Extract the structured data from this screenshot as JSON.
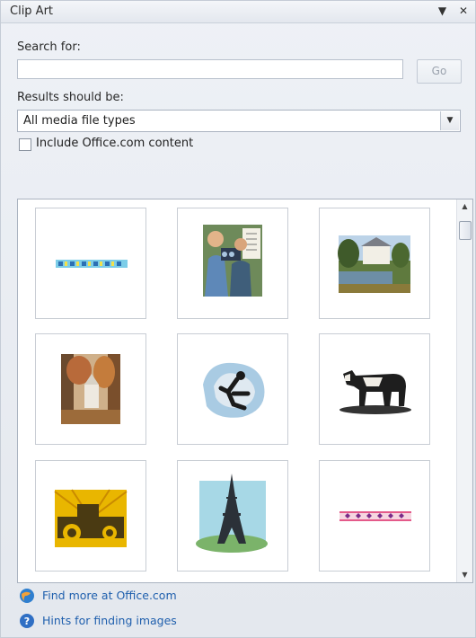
{
  "pane": {
    "title": "Clip Art",
    "menu_icon": "dropdown-arrow-icon",
    "close_icon": "close-icon"
  },
  "search": {
    "label": "Search for:",
    "value": "",
    "placeholder": "",
    "go_label": "Go"
  },
  "results_type": {
    "label": "Results should be:",
    "selected": "All media file types"
  },
  "include": {
    "label": "Include Office.com content",
    "checked": false
  },
  "results": {
    "items": [
      {
        "name": "decorative-border-blue-clipart"
      },
      {
        "name": "photographer-camera-clipart"
      },
      {
        "name": "country-house-lake-photo"
      },
      {
        "name": "church-autumn-trees-photo"
      },
      {
        "name": "dancer-abstract-clipart"
      },
      {
        "name": "cow-woodcut-clipart"
      },
      {
        "name": "tractor-clipart"
      },
      {
        "name": "eiffel-tower-clipart"
      },
      {
        "name": "decorative-border-pink-clipart"
      }
    ]
  },
  "footer": {
    "find_more": "Find more at Office.com",
    "hints": "Hints for finding images"
  },
  "colors": {
    "link": "#1f5fad",
    "pane_bg": "#e7ebf1"
  }
}
